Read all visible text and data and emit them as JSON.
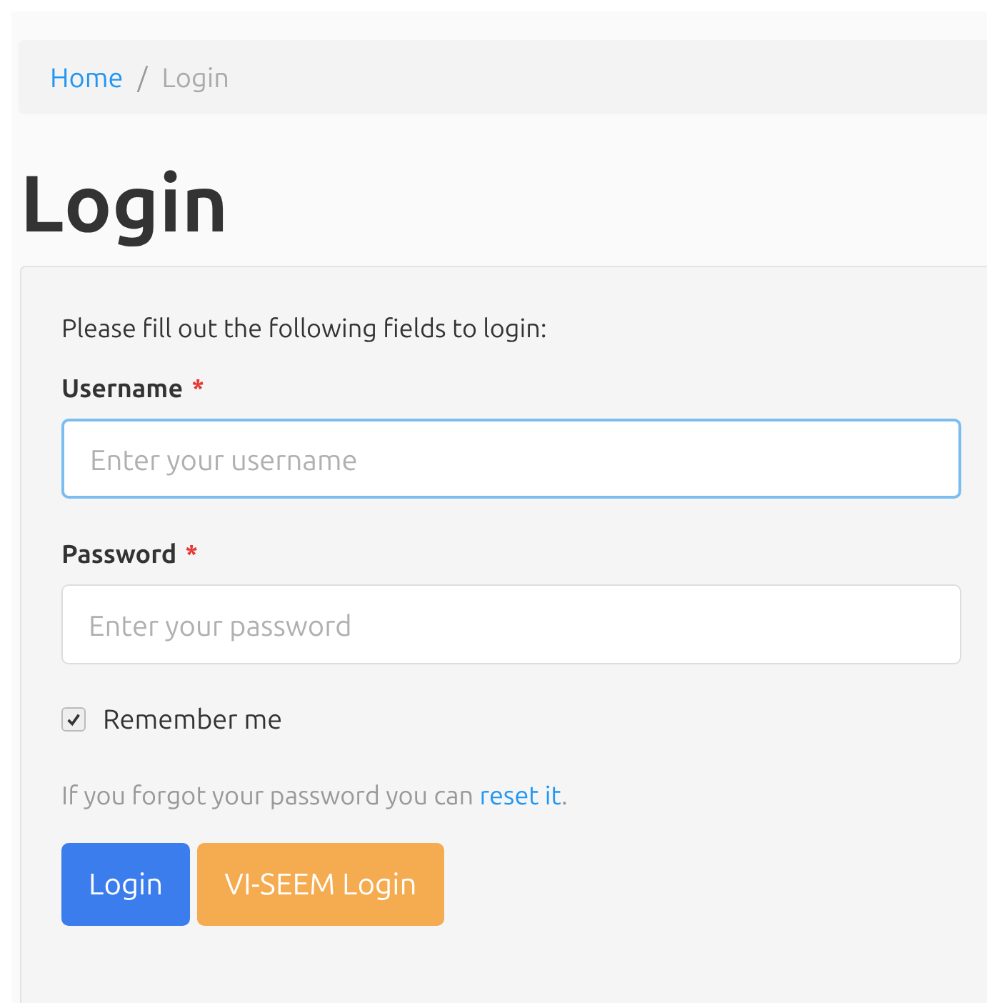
{
  "breadcrumb": [
    {
      "label": "Home",
      "kind": "link"
    },
    {
      "label": "/",
      "kind": "separator"
    },
    {
      "label": "Login",
      "kind": "current"
    }
  ],
  "title": "Login",
  "form": {
    "intro": "Please fill out the following fields to login:",
    "fields": [
      {
        "label": "Username",
        "required_mark": "*",
        "placeholder": "Enter your username",
        "focused": true
      },
      {
        "label": "Password",
        "required_mark": "*",
        "placeholder": "Enter your password",
        "focused": false
      }
    ],
    "remember": {
      "label": "Remember me",
      "checked": true
    },
    "forgot": {
      "text": "If you forgot your password you can ",
      "link": "reset it",
      "after": "."
    },
    "buttons": [
      {
        "label": "Login",
        "kind": "primary"
      },
      {
        "label": "VI-SEEM Login",
        "kind": "warning"
      }
    ]
  }
}
